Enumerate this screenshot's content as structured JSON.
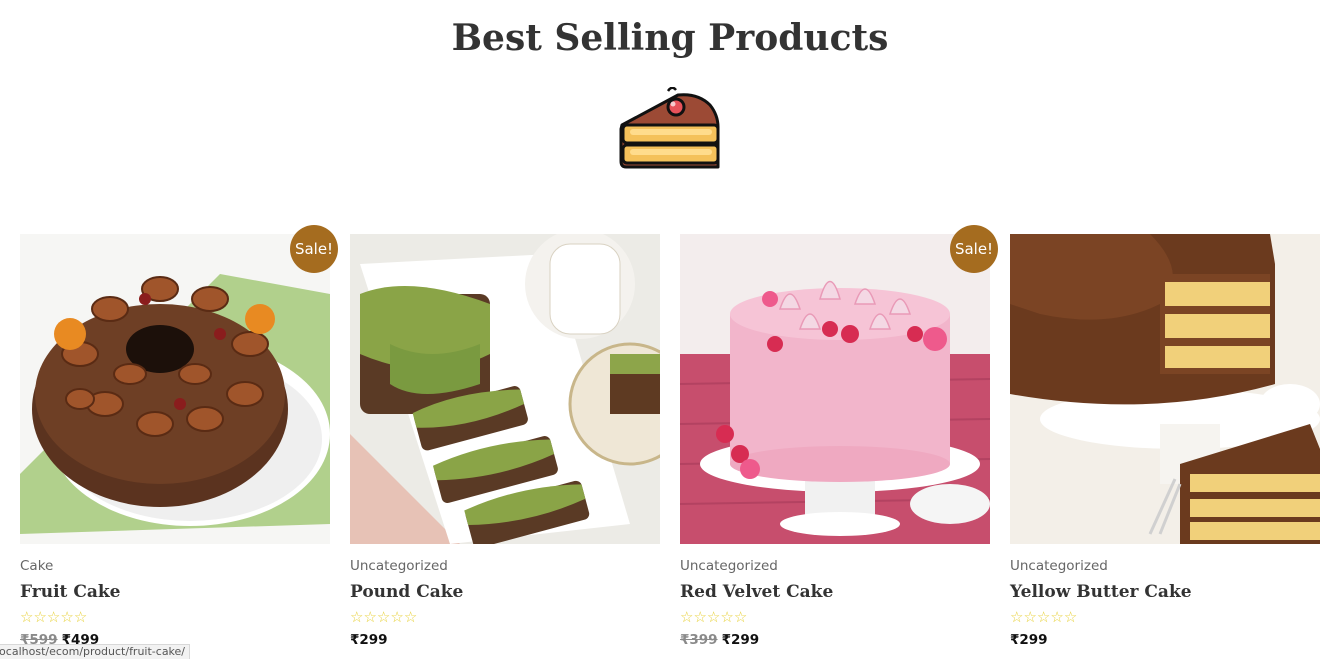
{
  "section": {
    "title": "Best Selling Products",
    "icon": "cake-slice-icon"
  },
  "products": [
    {
      "category": "Cake",
      "title": "Fruit Cake",
      "sale_badge": "Sale!",
      "rating": 0,
      "rating_max": 5,
      "price_old": "₹599",
      "price_new": "₹499",
      "image": "fruit-cake-image"
    },
    {
      "category": "Uncategorized",
      "title": "Pound Cake",
      "rating": 0,
      "rating_max": 5,
      "price_new": "₹299",
      "image": "pound-cake-image"
    },
    {
      "category": "Uncategorized",
      "title": "Red Velvet Cake",
      "sale_badge": "Sale!",
      "rating": 0,
      "rating_max": 5,
      "price_old": "₹399",
      "price_new": "₹299",
      "image": "red-velvet-cake-image"
    },
    {
      "category": "Uncategorized",
      "title": "Yellow Butter Cake",
      "rating": 0,
      "rating_max": 5,
      "price_new": "₹299",
      "image": "yellow-butter-cake-image"
    }
  ],
  "status_bar": {
    "url": "localhost/ecom/product/fruit-cake/"
  },
  "colors": {
    "sale_badge": "#a56c1f",
    "star": "#e8d23d",
    "title_text": "#333333"
  }
}
